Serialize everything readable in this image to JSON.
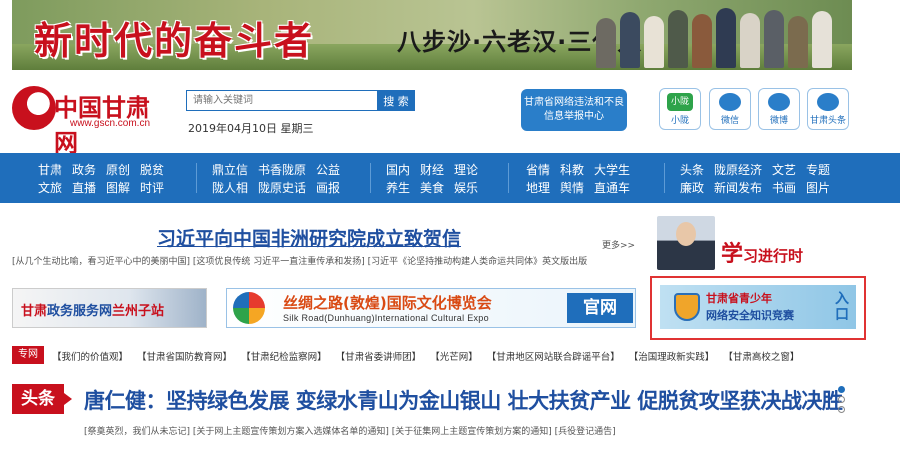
{
  "banner": {
    "title": "新时代的奋斗者",
    "subtitle": "八步沙·六老汉·三代人"
  },
  "header": {
    "logo_text": "中国甘肃网",
    "logo_url": "www.gscn.com.cn",
    "search_placeholder": "请输入关键词",
    "search_button": "搜 索",
    "date": "2019年04月10日 星期三",
    "report_button_line1": "甘肃省网络违法和不良",
    "report_button_line2": "信息举报中心",
    "social": [
      {
        "label": "小陇",
        "icon": "xiaolong-icon"
      },
      {
        "label": "微信",
        "icon": "wechat-icon"
      },
      {
        "label": "微博",
        "icon": "weibo-icon"
      },
      {
        "label": "甘肃头条",
        "icon": "gansu-toutiao-icon"
      }
    ]
  },
  "nav": {
    "groups": [
      [
        "甘肃",
        "文旅",
        "政务",
        "直播",
        "原创",
        "图解",
        "脱贫",
        "时评"
      ],
      [
        "鼎立信",
        "陇人相",
        "书香陇原",
        "陇原史话",
        "公益",
        "画报"
      ],
      [
        "国内",
        "养生",
        "财经",
        "美食",
        "理论",
        "娱乐"
      ],
      [
        "省情",
        "地理",
        "科教",
        "舆情",
        "大学生",
        "直通车"
      ],
      [
        "头条",
        "廉政",
        "陇原经济",
        "新闻发布",
        "文艺",
        "书画",
        "专题",
        "图片"
      ]
    ]
  },
  "main": {
    "headline1": "习近平向中国非洲研究院成立致贺信",
    "more": "更多>>",
    "sublinks": "[从几个生动比喻，看习近平心中的美丽中国] [这项优良传统 习近平一直注重传承和发扬] [习近平《论坚持推动构建人类命运共同体》英文版出版",
    "xi_badge_big": "学",
    "xi_badge_text": "习进行时"
  },
  "banners": {
    "gov_service_prefix": "甘肃",
    "gov_service": "政务服务网",
    "gov_service_city": "兰州子站",
    "silk_cn": "丝绸之路(敦煌)国际文化博览会",
    "silk_en": "Silk Road(Dunhuang)International Cultural Expo",
    "silk_official": "官网",
    "cyber_line1": "甘肃省青少年",
    "cyber_line2": "网络安全知识竞赛",
    "cyber_enter": "入口"
  },
  "special": {
    "tag": "专网",
    "links": [
      "【我们的价值观】",
      "【甘肃省国防教育网】",
      "【甘肃纪检监察网】",
      "【甘肃省委讲师团】",
      "【光芒网】",
      "【甘肃地区网站联合辟谣平台】",
      "【治国理政新实践】",
      "【甘肃高校之窗】"
    ]
  },
  "headline2": {
    "tag": "头条",
    "title": "唐仁健：坚持绿色发展 变绿水青山为金山银山 壮大扶贫产业 促脱贫攻坚获决战决胜",
    "sublinks": "[祭奠英烈，我们从未忘记] [关于网上主题宣传策划方案入选媒体名单的通知] [关于征集网上主题宣传策划方案的通知] [兵役登记通告]"
  },
  "colors": {
    "brand_red": "#c8101d",
    "nav_blue": "#1f6ebb",
    "headline_blue": "#1f4fa0"
  }
}
